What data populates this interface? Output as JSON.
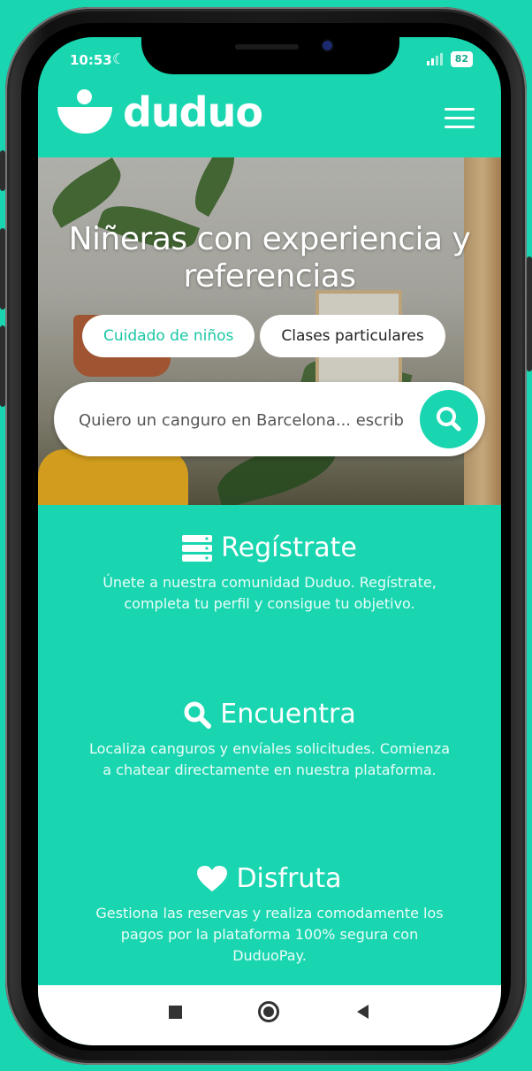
{
  "status": {
    "time": "10:53",
    "battery": "82"
  },
  "header": {
    "logo": "duduo",
    "menu_icon": "menu-icon"
  },
  "hero": {
    "title": "Niñeras con experiencia y referencias",
    "tabs": [
      {
        "label": "Cuidado de niños",
        "active": true
      },
      {
        "label": "Clases particulares",
        "active": false
      }
    ],
    "search": {
      "placeholder": "Quiero un canguro en Barcelona... escrib",
      "icon": "search-icon"
    }
  },
  "sections": [
    {
      "icon": "register-icon",
      "title": "Regístrate",
      "text": "Únete a nuestra comunidad Duduo. Regístrate, completa tu perfil y consigue tu objetivo."
    },
    {
      "icon": "search-icon",
      "title": "Encuentra",
      "text": "Localiza canguros y envíales solicitudes. Comienza a chatear directamente en nuestra plataforma."
    },
    {
      "icon": "heart-icon",
      "title": "Disfruta",
      "text": "Gestiona las reservas y realiza comodamente los pagos por la plataforma 100% segura con DuduoPay."
    }
  ],
  "navbar": {
    "items": [
      "recent-apps-icon",
      "home-icon",
      "back-icon"
    ]
  },
  "colors": {
    "brand": "#19d6b0",
    "frame": "#111111"
  }
}
